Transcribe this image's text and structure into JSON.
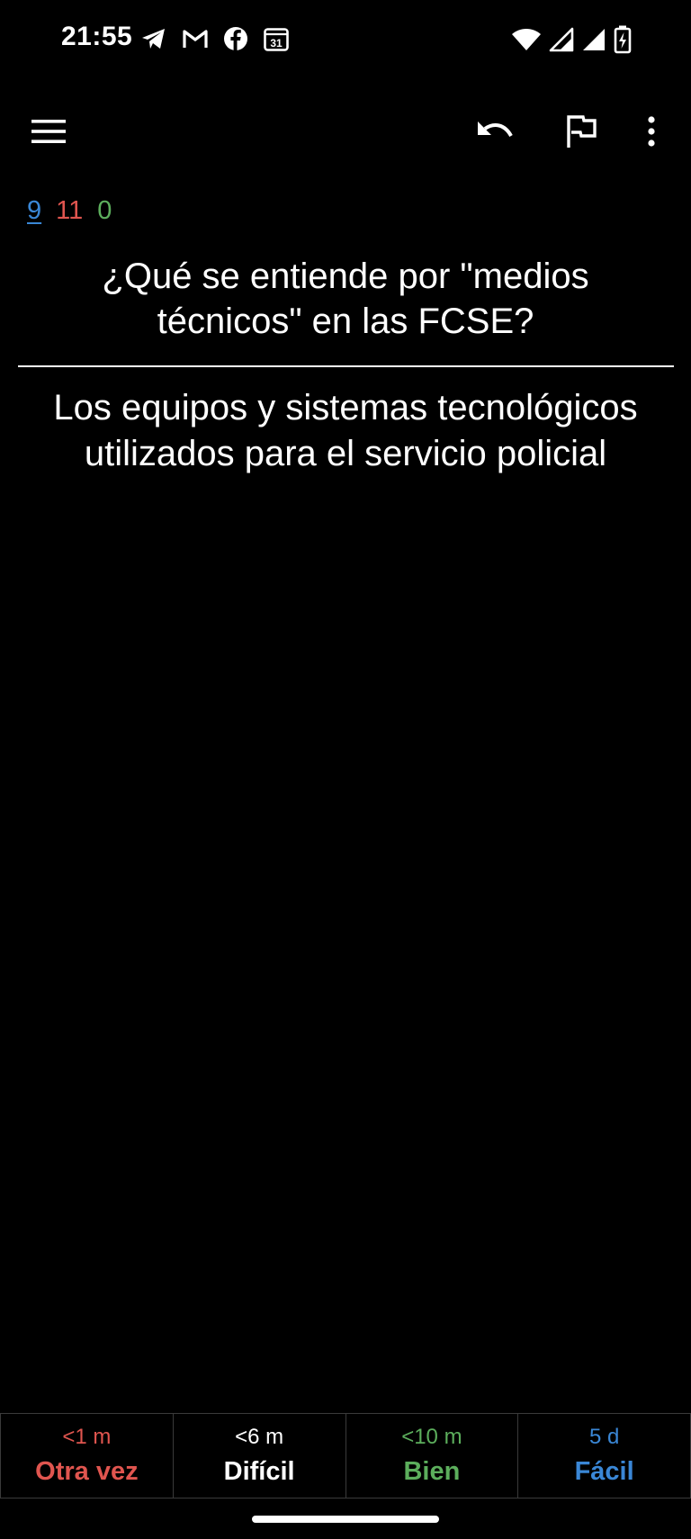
{
  "status_bar": {
    "time": "21:55",
    "left_icons": [
      "telegram-icon",
      "gmail-icon",
      "facebook-icon",
      "calendar-icon"
    ],
    "calendar_day": "31",
    "right_icons": [
      "wifi-icon",
      "signal-icon",
      "signal-icon",
      "battery-charging-icon"
    ]
  },
  "toolbar": {
    "icons": [
      "menu-icon",
      "undo-icon",
      "flag-icon",
      "more-vert-icon"
    ]
  },
  "counts": {
    "new": "9",
    "learning": "11",
    "review": "0"
  },
  "card": {
    "question": "¿Qué se entiende por \"medios técnicos\" en las FCSE?",
    "answer": "Los equipos y sistemas tecnológicos utilizados para el servicio policial"
  },
  "ease_buttons": [
    {
      "time": "<1 m",
      "label": "Otra vez",
      "color": "#e0554f"
    },
    {
      "time": "<6 m",
      "label": "Difícil",
      "color": "#ffffff"
    },
    {
      "time": "<10 m",
      "label": "Bien",
      "color": "#5cae5c"
    },
    {
      "time": "5 d",
      "label": "Fácil",
      "color": "#3a87d6"
    }
  ]
}
